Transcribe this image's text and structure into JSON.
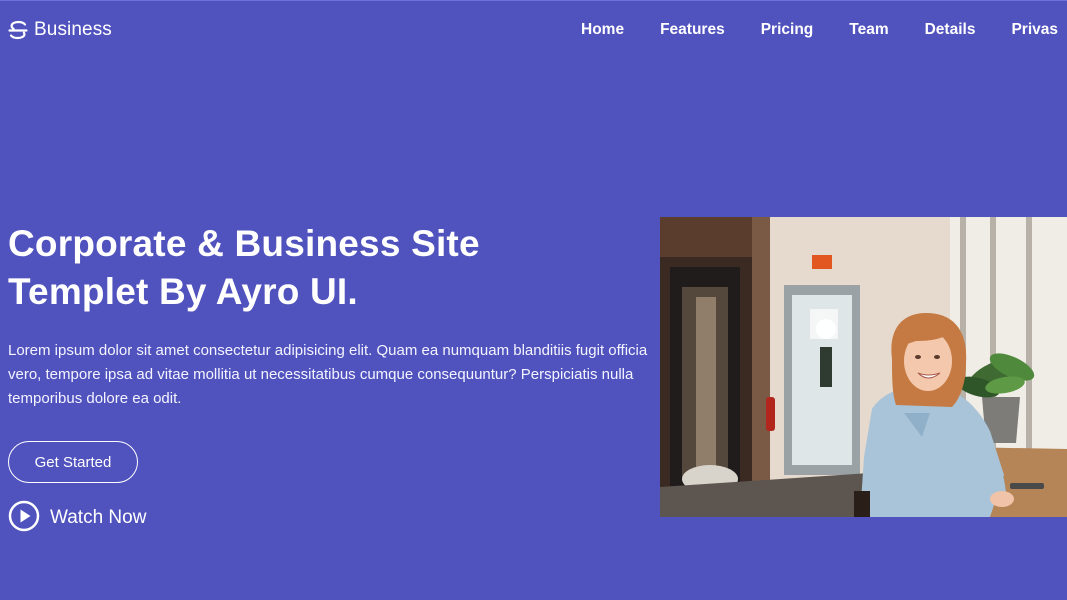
{
  "brand": {
    "name": "Business",
    "icon": "logo-icon"
  },
  "nav": {
    "items": [
      {
        "label": "Home"
      },
      {
        "label": "Features"
      },
      {
        "label": "Pricing"
      },
      {
        "label": "Team"
      },
      {
        "label": "Details"
      },
      {
        "label": "Privas"
      }
    ]
  },
  "hero": {
    "title_line1": "Corporate & Business Site",
    "title_line2": "Templet By Ayro UI.",
    "text": "Lorem ipsum dolor sit amet consectetur adipisicing elit. Quam ea numquam blanditiis fugit officia vero, tempore ipsa ad vitae mollitia ut necessitatibus cumque consequuntur? Perspiciatis nulla temporibus dolore ea odit.",
    "cta_label": "Get Started",
    "watch_label": "Watch Now",
    "watch_icon": "play-circle-icon",
    "image": "smiling-woman-cafe-photo"
  },
  "colors": {
    "background": "#5052be",
    "text": "#ffffff"
  }
}
